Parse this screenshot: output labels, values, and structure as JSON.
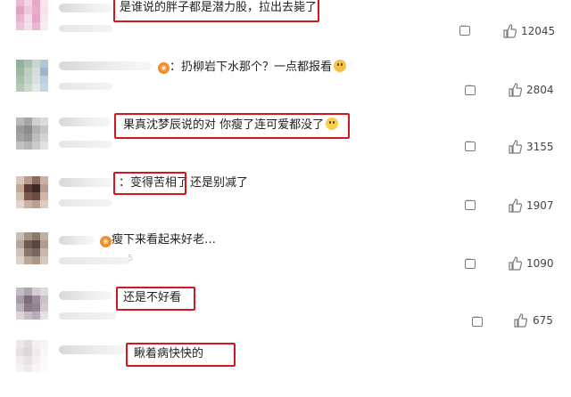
{
  "comments": [
    {
      "text": "是谁说的胖子都是潜力股，拉出去毙了",
      "emoji": "",
      "likes": "12045",
      "avatar": [
        "#e9b8d1",
        "#f1d6e3",
        "#e7a9c8",
        "#f5e6ee",
        "#e2a0c1",
        "#f0c8dc",
        "#eaaccb",
        "#f6e1ec",
        "#e8b4cf",
        "#f3dce8",
        "#e6a5c6",
        "#f7e8f0",
        "#eec3d8",
        "#f4e0eb",
        "#ebb7d0",
        "#f8ecf2"
      ]
    },
    {
      "text": "：扔柳岩下水那个？一点都报看",
      "emoji": "sweat",
      "likes": "2804",
      "avatar": [
        "#8fb39a",
        "#a7c2b0",
        "#c9d6cd",
        "#b3c6d8",
        "#9cb7a4",
        "#bcd0c2",
        "#d4dedb",
        "#9db4cd",
        "#a8bfa9",
        "#c2d1c6",
        "#d9e1df",
        "#bfcde0",
        "#b4c8b8",
        "#ccd7d0",
        "#e2e8e6",
        "#c8d4e4"
      ]
    },
    {
      "text": "果真沈梦辰说的对 你瘦了连可爱都没了",
      "emoji": "laugh",
      "likes": "3155",
      "avatar": [
        "#b9b9b9",
        "#a6a6a6",
        "#cfcfcf",
        "#dadada",
        "#9a9a9a",
        "#8c8c8c",
        "#b1b1b1",
        "#c6c6c6",
        "#a3a3a3",
        "#979797",
        "#bdbdbd",
        "#d4d4d4",
        "#c2c2c2",
        "#b5b5b5",
        "#cbcbcb",
        "#e1e1e1"
      ]
    },
    {
      "text": "：变得苦相了",
      "suffix": "还是别减了",
      "emoji": "",
      "likes": "1907",
      "avatar": [
        "#d9c6bd",
        "#b89a8c",
        "#8a6a5e",
        "#c9b1a6",
        "#c4a799",
        "#5b3b32",
        "#3e2a25",
        "#b99d90",
        "#d3beb4",
        "#7a5a4f",
        "#6b4c42",
        "#cdb6ab",
        "#e3d5ce",
        "#c8b0a5",
        "#b8a094",
        "#ddccc4"
      ]
    },
    {
      "text": "瘦下来看起来好老…",
      "emoji": "",
      "likes": "1090",
      "avatar": [
        "#c9bdb5",
        "#a69387",
        "#8d7a6e",
        "#bfb0a6",
        "#b7a69b",
        "#6e5a4e",
        "#5a463c",
        "#b09d91",
        "#cfc3bb",
        "#8a766a",
        "#7a665a",
        "#c6b8ae",
        "#ddd3cc",
        "#b8a89c",
        "#a99789",
        "#d5cac2"
      ]
    },
    {
      "text": "还是不好看",
      "emoji": "",
      "likes": "675",
      "avatar": [
        "#c4bcc4",
        "#b0a4ae",
        "#d5cdd3",
        "#e0dae0",
        "#a99ba7",
        "#7e6e7c",
        "#9c8c9a",
        "#cbc1c9",
        "#bdb1bb",
        "#8c7c8a",
        "#958593",
        "#d2c9d0",
        "#ddd5db",
        "#c7bdc5",
        "#b9adb7",
        "#e6e1e5"
      ]
    },
    {
      "text": "瞅着病快快的",
      "emoji": "",
      "likes": "",
      "avatar": [
        "#ece8e8",
        "#e2dcdc",
        "#f2efef",
        "#f6f4f4",
        "#e6e1e1",
        "#ddd7d7",
        "#efebeb",
        "#f8f6f6",
        "#f0eded",
        "#e8e3e3",
        "#f4f1f1",
        "#fafafa",
        "#f5f3f3",
        "#eeeaea",
        "#f7f5f5",
        "#fcfcfc"
      ]
    }
  ],
  "faint_number": "5",
  "colors": {
    "highlight": "#d4161e",
    "emoji": "#f6c94a",
    "badge": "#f28c2a"
  }
}
